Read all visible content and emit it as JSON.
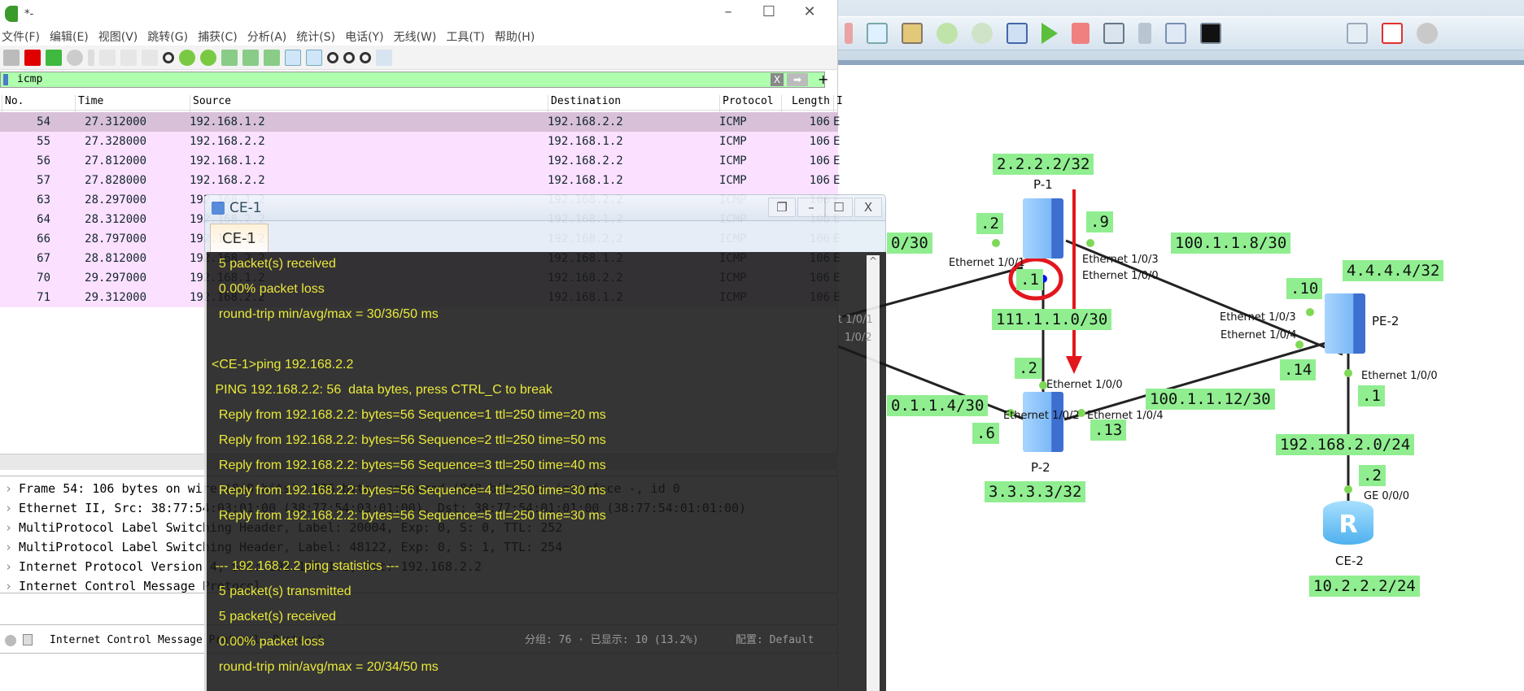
{
  "wireshark": {
    "title": "*-",
    "menu": [
      "文件(F)",
      "编辑(E)",
      "视图(V)",
      "跳转(G)",
      "捕获(C)",
      "分析(A)",
      "统计(S)",
      "电话(Y)",
      "无线(W)",
      "工具(T)",
      "帮助(H)"
    ],
    "filter": {
      "value": "icmp",
      "clear": "X",
      "apply": "➡",
      "add": "+"
    },
    "columns": [
      "No.",
      "Time",
      "Source",
      "Destination",
      "Protocol",
      "Length",
      "I"
    ],
    "packets": [
      {
        "no": "54",
        "time": "27.312000",
        "src": "192.168.1.2",
        "dst": "192.168.2.2",
        "proto": "ICMP",
        "len": "106",
        "info": "E"
      },
      {
        "no": "55",
        "time": "27.328000",
        "src": "192.168.2.2",
        "dst": "192.168.1.2",
        "proto": "ICMP",
        "len": "106",
        "info": "E"
      },
      {
        "no": "56",
        "time": "27.812000",
        "src": "192.168.1.2",
        "dst": "192.168.2.2",
        "proto": "ICMP",
        "len": "106",
        "info": "E"
      },
      {
        "no": "57",
        "time": "27.828000",
        "src": "192.168.2.2",
        "dst": "192.168.1.2",
        "proto": "ICMP",
        "len": "106",
        "info": "E"
      },
      {
        "no": "63",
        "time": "28.297000",
        "src": "192.168.1.2",
        "dst": "192.168.2.2",
        "proto": "ICMP",
        "len": "106",
        "info": "E"
      },
      {
        "no": "64",
        "time": "28.312000",
        "src": "192.168.2.2",
        "dst": "192.168.1.2",
        "proto": "ICMP",
        "len": "106",
        "info": "E"
      },
      {
        "no": "66",
        "time": "28.797000",
        "src": "192.168.1.2",
        "dst": "192.168.2.2",
        "proto": "ICMP",
        "len": "106",
        "info": "E"
      },
      {
        "no": "67",
        "time": "28.812000",
        "src": "192.168.2.2",
        "dst": "192.168.1.2",
        "proto": "ICMP",
        "len": "106",
        "info": "E"
      },
      {
        "no": "70",
        "time": "29.297000",
        "src": "192.168.1.2",
        "dst": "192.168.2.2",
        "proto": "ICMP",
        "len": "106",
        "info": "E"
      },
      {
        "no": "71",
        "time": "29.312000",
        "src": "192.168.2.2",
        "dst": "192.168.1.2",
        "proto": "ICMP",
        "len": "106",
        "info": "E"
      }
    ],
    "details": [
      "Frame 54: 106 bytes on wire (848 bits), 106 bytes captured (848 bits) on interface -, id 0",
      "Ethernet II, Src: 38:77:54:03:01:00 (38:77:54:03:01:00), Dst: 38:77:54:01:01:00 (38:77:54:01:01:00)",
      "MultiProtocol Label Switching Header, Label: 20004, Exp: 0, S: 0, TTL: 252",
      "MultiProtocol Label Switching Header, Label: 48122, Exp: 0, S: 1, TTL: 254",
      "Internet Protocol Version 4, Src: 192.168.1.2, Dst: 192.168.2.2",
      "Internet Control Message Protocol"
    ],
    "status": {
      "field": "Internet Control Message Protocol: Protocol",
      "packets": "分组: 76 · 已显示: 10 (13.2%)",
      "profile": "配置: Default"
    }
  },
  "console": {
    "title": "CE-1",
    "tab": "CE-1",
    "lines": [
      "  5 packet(s) received",
      "  0.00% packet loss",
      "  round-trip min/avg/max = 30/36/50 ms",
      "",
      "<CE-1>ping 192.168.2.2",
      " PING 192.168.2.2: 56  data bytes, press CTRL_C to break",
      "  Reply from 192.168.2.2: bytes=56 Sequence=1 ttl=250 time=20 ms",
      "  Reply from 192.168.2.2: bytes=56 Sequence=2 ttl=250 time=50 ms",
      "  Reply from 192.168.2.2: bytes=56 Sequence=3 ttl=250 time=40 ms",
      "  Reply from 192.168.2.2: bytes=56 Sequence=4 ttl=250 time=30 ms",
      "  Reply from 192.168.2.2: bytes=56 Sequence=5 ttl=250 time=30 ms",
      "",
      " --- 192.168.2.2 ping statistics ---",
      "  5 packet(s) transmitted",
      "  5 packet(s) received",
      "  0.00% packet loss",
      "  round-trip min/avg/max = 20/34/50 ms"
    ]
  },
  "topology": {
    "devices": [
      "P-1",
      "P-2",
      "PE-2",
      "CE-2"
    ],
    "labels": {
      "p1_lo": "2.2.2.2/32",
      "p2_lo": "3.3.3.3/32",
      "pe2_lo": "4.4.4.4/32",
      "ce2_lo": "10.2.2.2/24",
      "net_p1p2": "111.1.1.0/30",
      "net_p1pe2": "100.1.1.8/30",
      "net_p2pe2": "100.1.1.12/30",
      "net_pe2ce2": "192.168.2.0/24",
      "net_left_top": "0/30",
      "net_left_bottom": "0.1.1.4/30",
      "p1_left": ".2",
      "p1_right": ".9",
      "p1_down": ".1",
      "p2_up": ".2",
      "p2_left": ".6",
      "p2_right": ".13",
      "pe2_up": ".10",
      "pe2_left": ".14",
      "pe2_down": ".1",
      "ce2_up": ".2"
    },
    "interfaces": {
      "p1_e1": "Ethernet 1/0/1",
      "p1_e3": "Ethernet 1/0/3",
      "p1_e0": "Ethernet 1/0/0",
      "p2_e0": "Ethernet 1/0/0",
      "p2_e2": "Ethernet 1/0/2",
      "p2_e4": "Ethernet 1/0/4",
      "pe2_e3": "Ethernet 1/0/3",
      "pe2_e4": "Ethernet 1/0/4",
      "pe2_e0": "Ethernet 1/0/0",
      "ce2_ge": "GE 0/0/0",
      "left1": "t 1/0/1",
      "left2": "1/0/2"
    },
    "annotation_color": "#e3161d",
    "link_dot_color": "#7ed957",
    "label_bg": "#90ee90"
  }
}
